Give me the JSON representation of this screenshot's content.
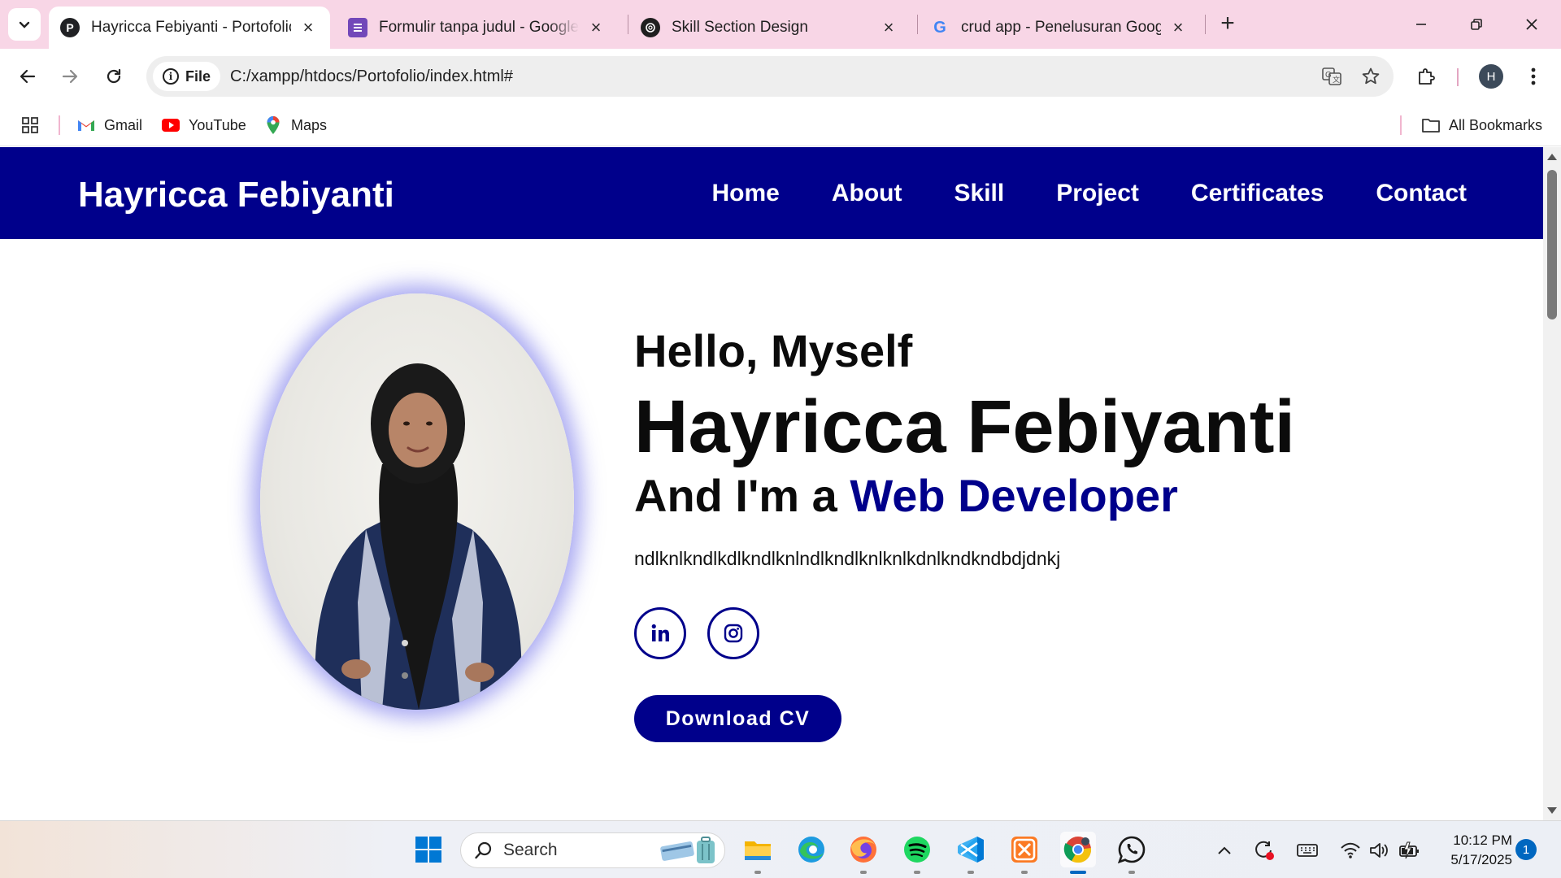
{
  "browser": {
    "tabs": [
      {
        "title": "Hayricca Febiyanti - Portofolio",
        "favicon": "P",
        "active": true
      },
      {
        "title": "Formulir tanpa judul - Google F",
        "favicon": "forms-icon",
        "active": false
      },
      {
        "title": "Skill Section Design",
        "favicon": "chatgpt-icon",
        "active": false
      },
      {
        "title": "crud app - Penelusuran Google",
        "favicon": "G",
        "active": false
      }
    ],
    "omnibox": {
      "chip_label": "File",
      "url": "C:/xampp/htdocs/Portofolio/index.html#"
    },
    "profile_initial": "H",
    "bookmarks": [
      {
        "label": "Gmail",
        "icon": "gmail-icon"
      },
      {
        "label": "YouTube",
        "icon": "youtube-icon"
      },
      {
        "label": "Maps",
        "icon": "maps-icon"
      }
    ],
    "all_bookmarks_label": "All Bookmarks"
  },
  "site": {
    "logo": "Hayricca Febiyanti",
    "nav": [
      "Home",
      "About",
      "Skill",
      "Project",
      "Certificates",
      "Contact"
    ],
    "hero": {
      "greeting": "Hello, Myself",
      "name": "Hayricca Febiyanti",
      "role_prefix": "And I'm a ",
      "role": "Web Developer",
      "bio": "ndlknlkndlkdlkndlknlndlkndlknlknlkdnlkndkndbdjdnkj",
      "cta": "Download CV",
      "socials": [
        "linkedin-icon",
        "instagram-icon"
      ]
    },
    "colors": {
      "primary": "#00008b",
      "text": "#0b0b0b",
      "photo_glow": "#5c5ce6"
    }
  },
  "taskbar": {
    "search_label": "Search",
    "apps": [
      "windows-start-icon",
      "file-explorer-icon",
      "edge-icon",
      "firefox-icon",
      "spotify-icon",
      "vscode-icon",
      "xampp-icon",
      "chrome-icon",
      "whatsapp-icon"
    ],
    "time": "10:12 PM",
    "date": "5/17/2025",
    "notification_count": "1"
  }
}
